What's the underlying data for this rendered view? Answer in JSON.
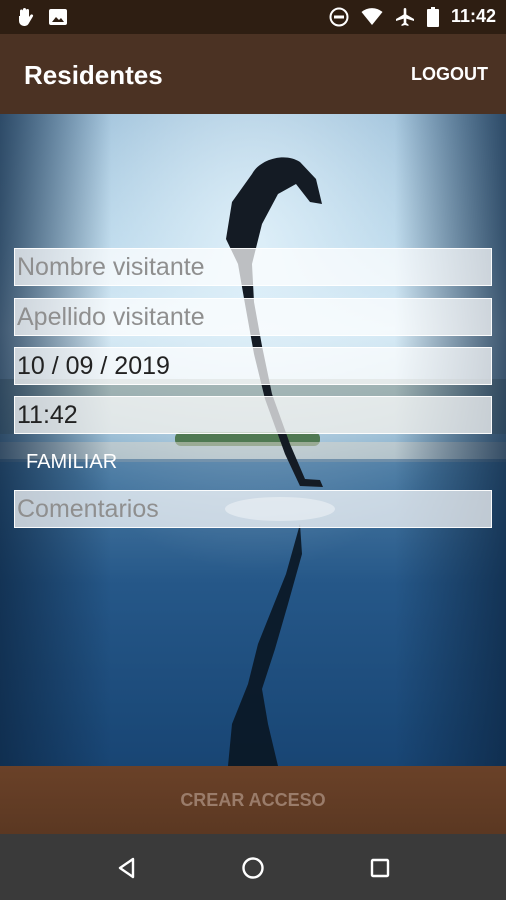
{
  "status_bar": {
    "time": "11:42",
    "left_icons": [
      "hand-icon",
      "image-icon"
    ],
    "right_icons": [
      "do-not-disturb-icon",
      "wifi-icon",
      "airplane-icon",
      "battery-icon"
    ]
  },
  "app_bar": {
    "title": "Residentes",
    "logout_label": "LOGOUT"
  },
  "form": {
    "nombre_placeholder": "Nombre visitante",
    "apellido_placeholder": "Apellido visitante",
    "date_value": "10 / 09 / 2019",
    "time_value": "11:42",
    "type_label": "FAMILIAR",
    "comentarios_placeholder": "Comentarios"
  },
  "action": {
    "create_label": "CREAR ACCESO"
  },
  "nav_bar": {
    "icons": [
      "back-icon",
      "home-icon",
      "recents-icon"
    ]
  },
  "colors": {
    "status_bar": "#2e1e12",
    "app_bar": "#4b3223",
    "button": "#5b3822",
    "nav_bar": "#3a3a3a"
  }
}
